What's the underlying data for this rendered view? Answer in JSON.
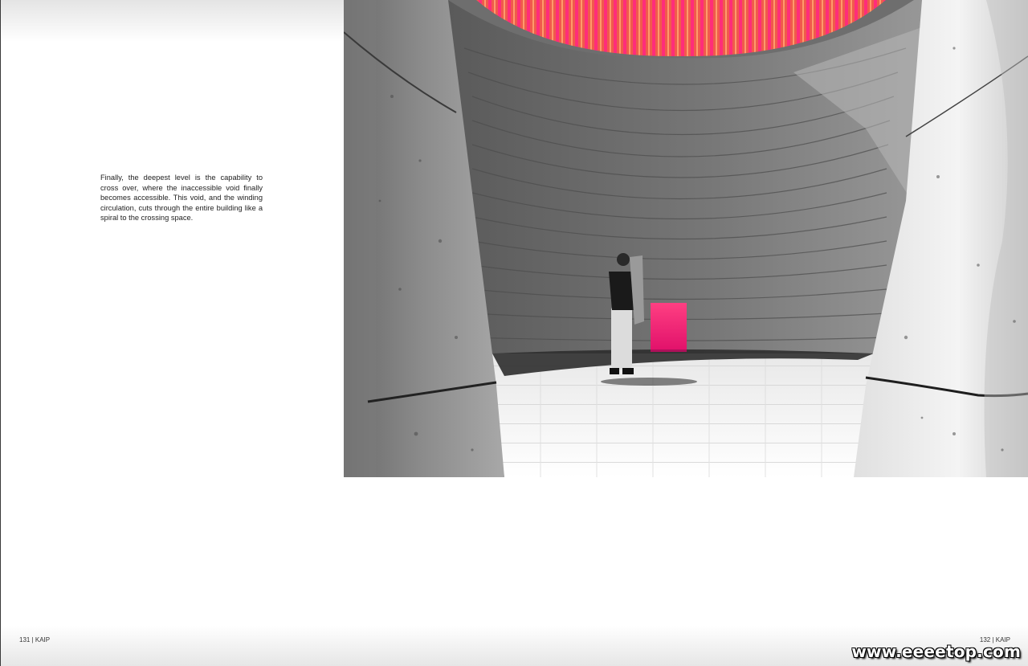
{
  "page_left": {
    "body_text": "Finally, the deepest level is the capability to cross over, where the inaccessible void finally becomes accessible. This void, and the winding circulation, cuts through the entire building like a spiral to the crossing space.",
    "folio": "131  |  KAIP"
  },
  "page_right": {
    "folio": "132  |  KAIP"
  },
  "photo": {
    "icon": "monochrome-photo-concrete-void-icon",
    "accent_colors": [
      "#ff1f6e",
      "#f36a4a"
    ]
  },
  "watermark": "www.eeeetop.com"
}
